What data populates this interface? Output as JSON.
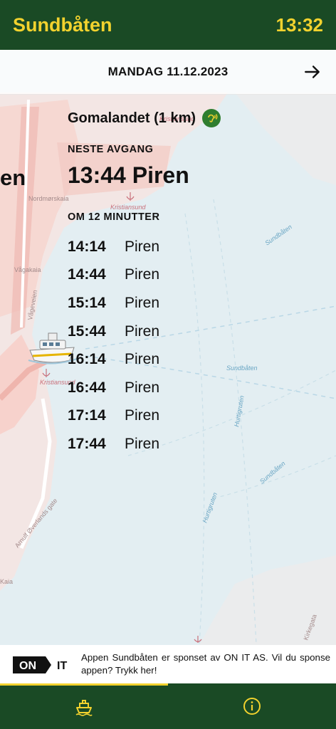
{
  "header": {
    "app_title": "Sundbåten",
    "clock": "13:32"
  },
  "date_bar": {
    "date": "MANDAG 11.12.2023",
    "next_icon": "arrow-right-icon"
  },
  "map": {
    "partial_label": "en",
    "labels": [
      "Holmøyrkia",
      "Kristiansund",
      "Nordmørskaia",
      "Kristiansund",
      "Vågakaia",
      "Vågeveien",
      "Sundbåten",
      "Sundbåten",
      "Kristiansund",
      "Sundbåten",
      "Hurtigruten",
      "Hurtigruten",
      "Arnulf Øverlands gate",
      "Kaia",
      "Sundbåten",
      "Kirkegata",
      "Fosnagata",
      "Kaia"
    ]
  },
  "schedule": {
    "stop_name": "Gomalandet (1 km)",
    "next_label": "NESTE AVGANG",
    "next_departure": "13:44 Piren",
    "countdown": "OM 12 MINUTTER",
    "departures": [
      {
        "time": "14:14",
        "dest": "Piren"
      },
      {
        "time": "14:44",
        "dest": "Piren"
      },
      {
        "time": "15:14",
        "dest": "Piren"
      },
      {
        "time": "15:44",
        "dest": "Piren"
      },
      {
        "time": "16:14",
        "dest": "Piren"
      },
      {
        "time": "16:44",
        "dest": "Piren"
      },
      {
        "time": "17:14",
        "dest": "Piren"
      },
      {
        "time": "17:44",
        "dest": "Piren"
      }
    ]
  },
  "sponsor": {
    "logo_on": "ON",
    "logo_it": "IT",
    "text": "Appen Sundbåten er sponset av ON IT AS. Vil du sponse appen? Trykk her!"
  },
  "bottom_nav": {
    "tabs": [
      {
        "icon": "ferry-icon",
        "active": true
      },
      {
        "icon": "info-icon",
        "active": false
      }
    ]
  },
  "colors": {
    "brand_green": "#1a4a25",
    "brand_yellow": "#f2d22e",
    "water": "#e3eef2",
    "land": "#f1e4e2"
  }
}
